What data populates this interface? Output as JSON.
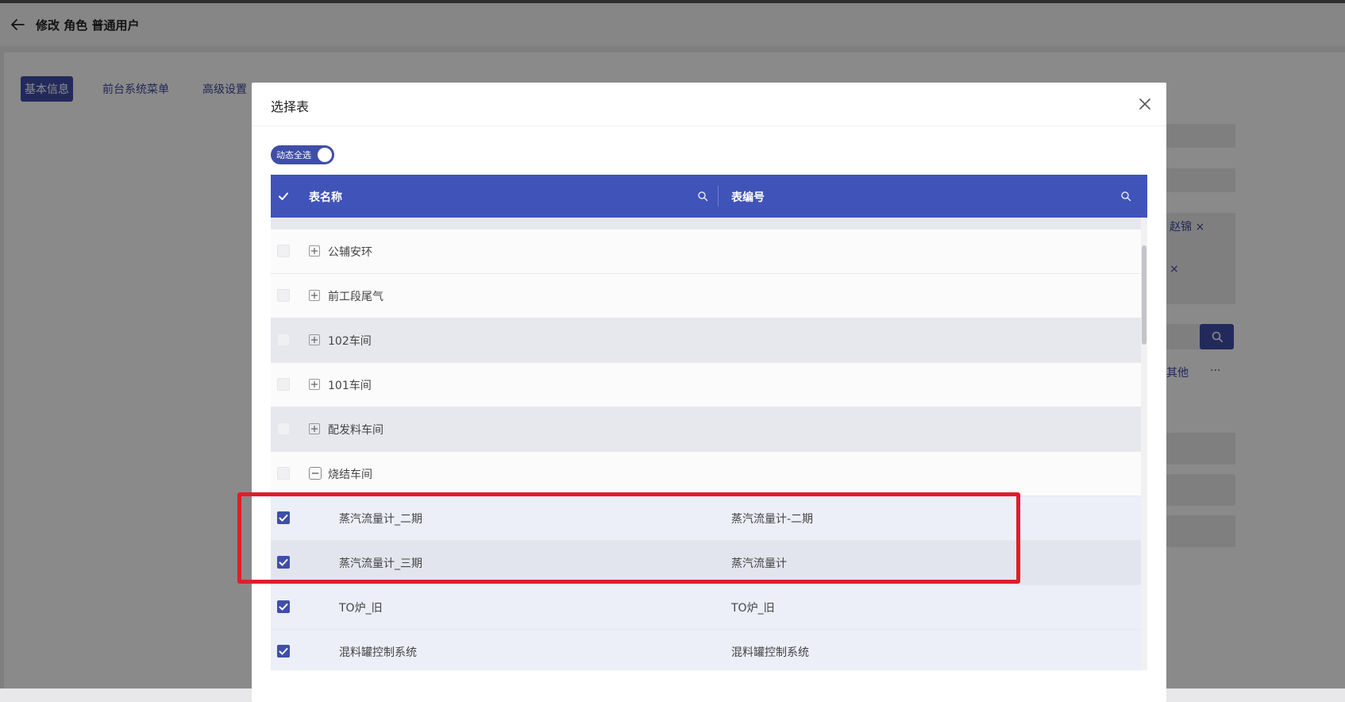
{
  "page": {
    "title": "修改 角色 普通用户",
    "tabs": [
      {
        "label": "基本信息",
        "active": true
      },
      {
        "label": "前台系统菜单",
        "active": false
      },
      {
        "label": "高级设置",
        "active": false
      }
    ],
    "bg_tags": [
      "赵锦 ×",
      "×"
    ],
    "bg_more_label": "其他",
    "bg_ellipsis": "···"
  },
  "dialog": {
    "title": "选择表",
    "toggle_label": "动态全选",
    "toggle_on": true,
    "columns": [
      "表名称",
      "表编号"
    ],
    "groups": [
      {
        "name": "公辅安环",
        "expanded": false
      },
      {
        "name": "前工段尾气",
        "expanded": false
      },
      {
        "name": "102车间",
        "expanded": false
      },
      {
        "name": "101车间",
        "expanded": false
      },
      {
        "name": "配发料车间",
        "expanded": false
      },
      {
        "name": "烧结车间",
        "expanded": true
      }
    ],
    "rows": [
      {
        "name": "蒸汽流量计_二期",
        "code": "蒸汽流量计-二期",
        "checked": true
      },
      {
        "name": "蒸汽流量计_三期",
        "code": "蒸汽流量计",
        "checked": true
      },
      {
        "name": "TO炉_旧",
        "code": "TO炉_旧",
        "checked": true
      },
      {
        "name": "混料罐控制系统",
        "code": "混料罐控制系统",
        "checked": true
      }
    ]
  },
  "colors": {
    "primary": "#3f4ea8",
    "table_header": "#4053b8",
    "highlight": "#e01d2a"
  }
}
